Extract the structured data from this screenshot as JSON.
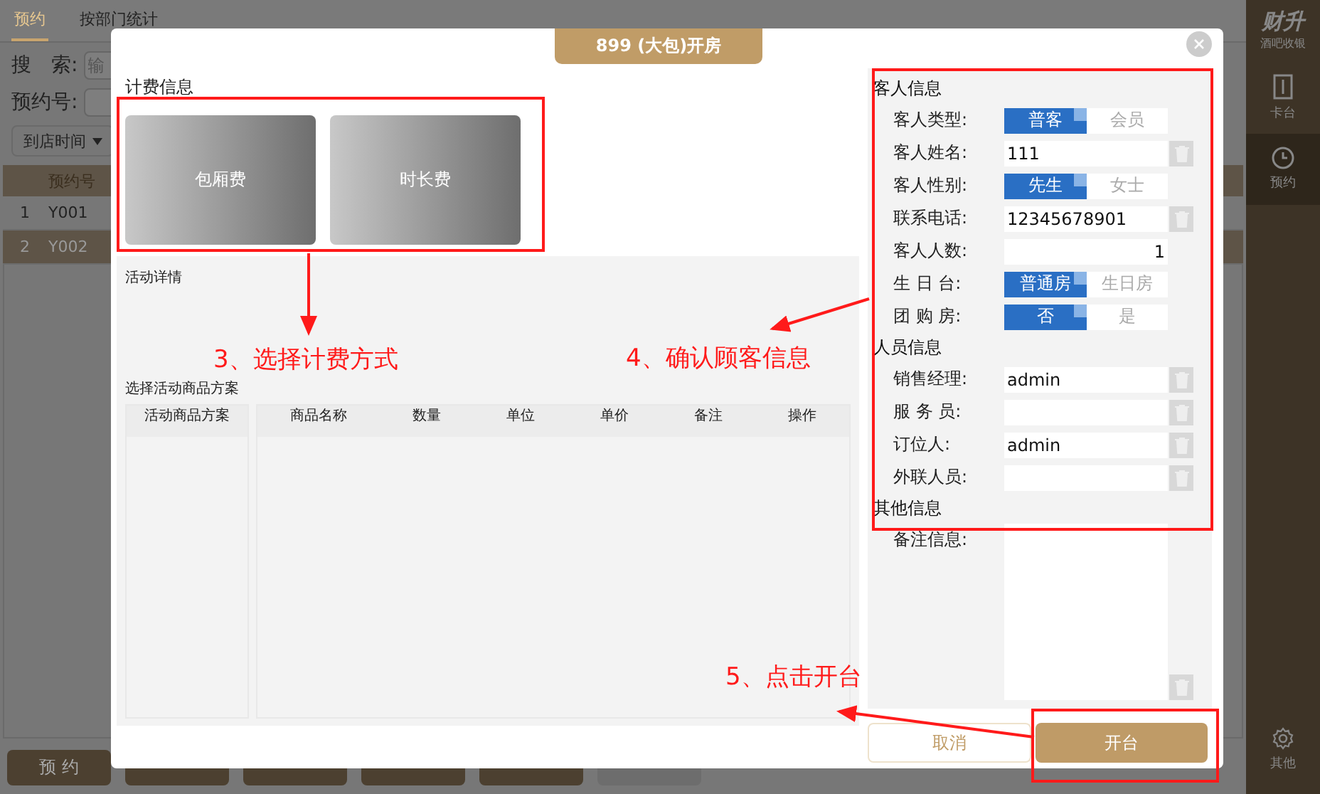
{
  "app": {
    "tabs": [
      {
        "label": "预约",
        "selected": true
      },
      {
        "label": "按部门统计",
        "selected": false
      }
    ],
    "search": {
      "label": "搜　索:",
      "placeholder": "输"
    },
    "reservation_no": {
      "label": "预约号:"
    },
    "sort_dropdown": {
      "label": "到店时间"
    },
    "table": {
      "columns": [
        "",
        "预约号"
      ],
      "rows": [
        {
          "cells": [
            "1",
            "Y001"
          ],
          "selected": false
        },
        {
          "cells": [
            "2",
            "Y002"
          ],
          "selected": true
        }
      ]
    },
    "actions": [
      {
        "label": "预 约",
        "disabled": false
      },
      {
        "disabled": false
      },
      {
        "disabled": false
      },
      {
        "disabled": false
      },
      {
        "disabled": false
      },
      {
        "disabled": true
      }
    ]
  },
  "sidebar": {
    "logo": "财升",
    "subtitle": "酒吧收银",
    "items": [
      {
        "label": "卡台",
        "kind": "card",
        "selected": false
      },
      {
        "label": "预约",
        "kind": "clock",
        "selected": true
      },
      {
        "label": "其他",
        "kind": "gear",
        "selected": false
      }
    ]
  },
  "dialog": {
    "title": "899 (大包)开房",
    "billing": {
      "heading": "计费信息",
      "options": [
        {
          "label": "包厢费"
        },
        {
          "label": "时长费"
        }
      ]
    },
    "activity_heading": "活动详情",
    "plan_heading": "选择活动商品方案",
    "plan_table": {
      "columns": [
        "活动商品方案"
      ]
    },
    "goods_table": {
      "columns": [
        "商品名称",
        "数量",
        "单位",
        "单价",
        "备注",
        "操作"
      ]
    },
    "sections": [
      {
        "heading": "客人信息",
        "fields": [
          {
            "label": "客人类型:",
            "kind": "toggle",
            "options": [
              {
                "label": "普客",
                "selected": true
              },
              {
                "label": "会员",
                "selected": false
              }
            ]
          },
          {
            "label": "客人姓名:",
            "kind": "text",
            "value": "111"
          },
          {
            "label": "客人性别:",
            "kind": "toggle",
            "options": [
              {
                "label": "先生",
                "selected": true
              },
              {
                "label": "女士",
                "selected": false
              }
            ]
          },
          {
            "label": "联系电话:",
            "kind": "text",
            "value": "12345678901"
          },
          {
            "label": "客人人数:",
            "kind": "number",
            "value": "1"
          },
          {
            "label": "生 日 台:",
            "kind": "toggle",
            "options": [
              {
                "label": "普通房",
                "selected": true
              },
              {
                "label": "生日房",
                "selected": false
              }
            ]
          },
          {
            "label": "团 购 房:",
            "kind": "toggle",
            "options": [
              {
                "label": "否",
                "selected": true
              },
              {
                "label": "是",
                "selected": false
              }
            ]
          }
        ]
      },
      {
        "heading": "人员信息",
        "fields": [
          {
            "label": "销售经理:",
            "kind": "text",
            "value": "admin"
          },
          {
            "label": "服 务 员:",
            "kind": "text"
          },
          {
            "label": "订位人:",
            "kind": "text",
            "value": "admin"
          },
          {
            "label": "外联人员:",
            "kind": "text"
          }
        ]
      },
      {
        "heading": "其他信息",
        "fields": [
          {
            "label": "备注信息:",
            "kind": "textarea"
          }
        ]
      }
    ],
    "cancel_button": "取消",
    "confirm_button": "开台"
  },
  "annotations": [
    {
      "text": "3、选择计费方式"
    },
    {
      "text": "4、确认顾客信息"
    },
    {
      "text": "5、点击开台"
    }
  ]
}
